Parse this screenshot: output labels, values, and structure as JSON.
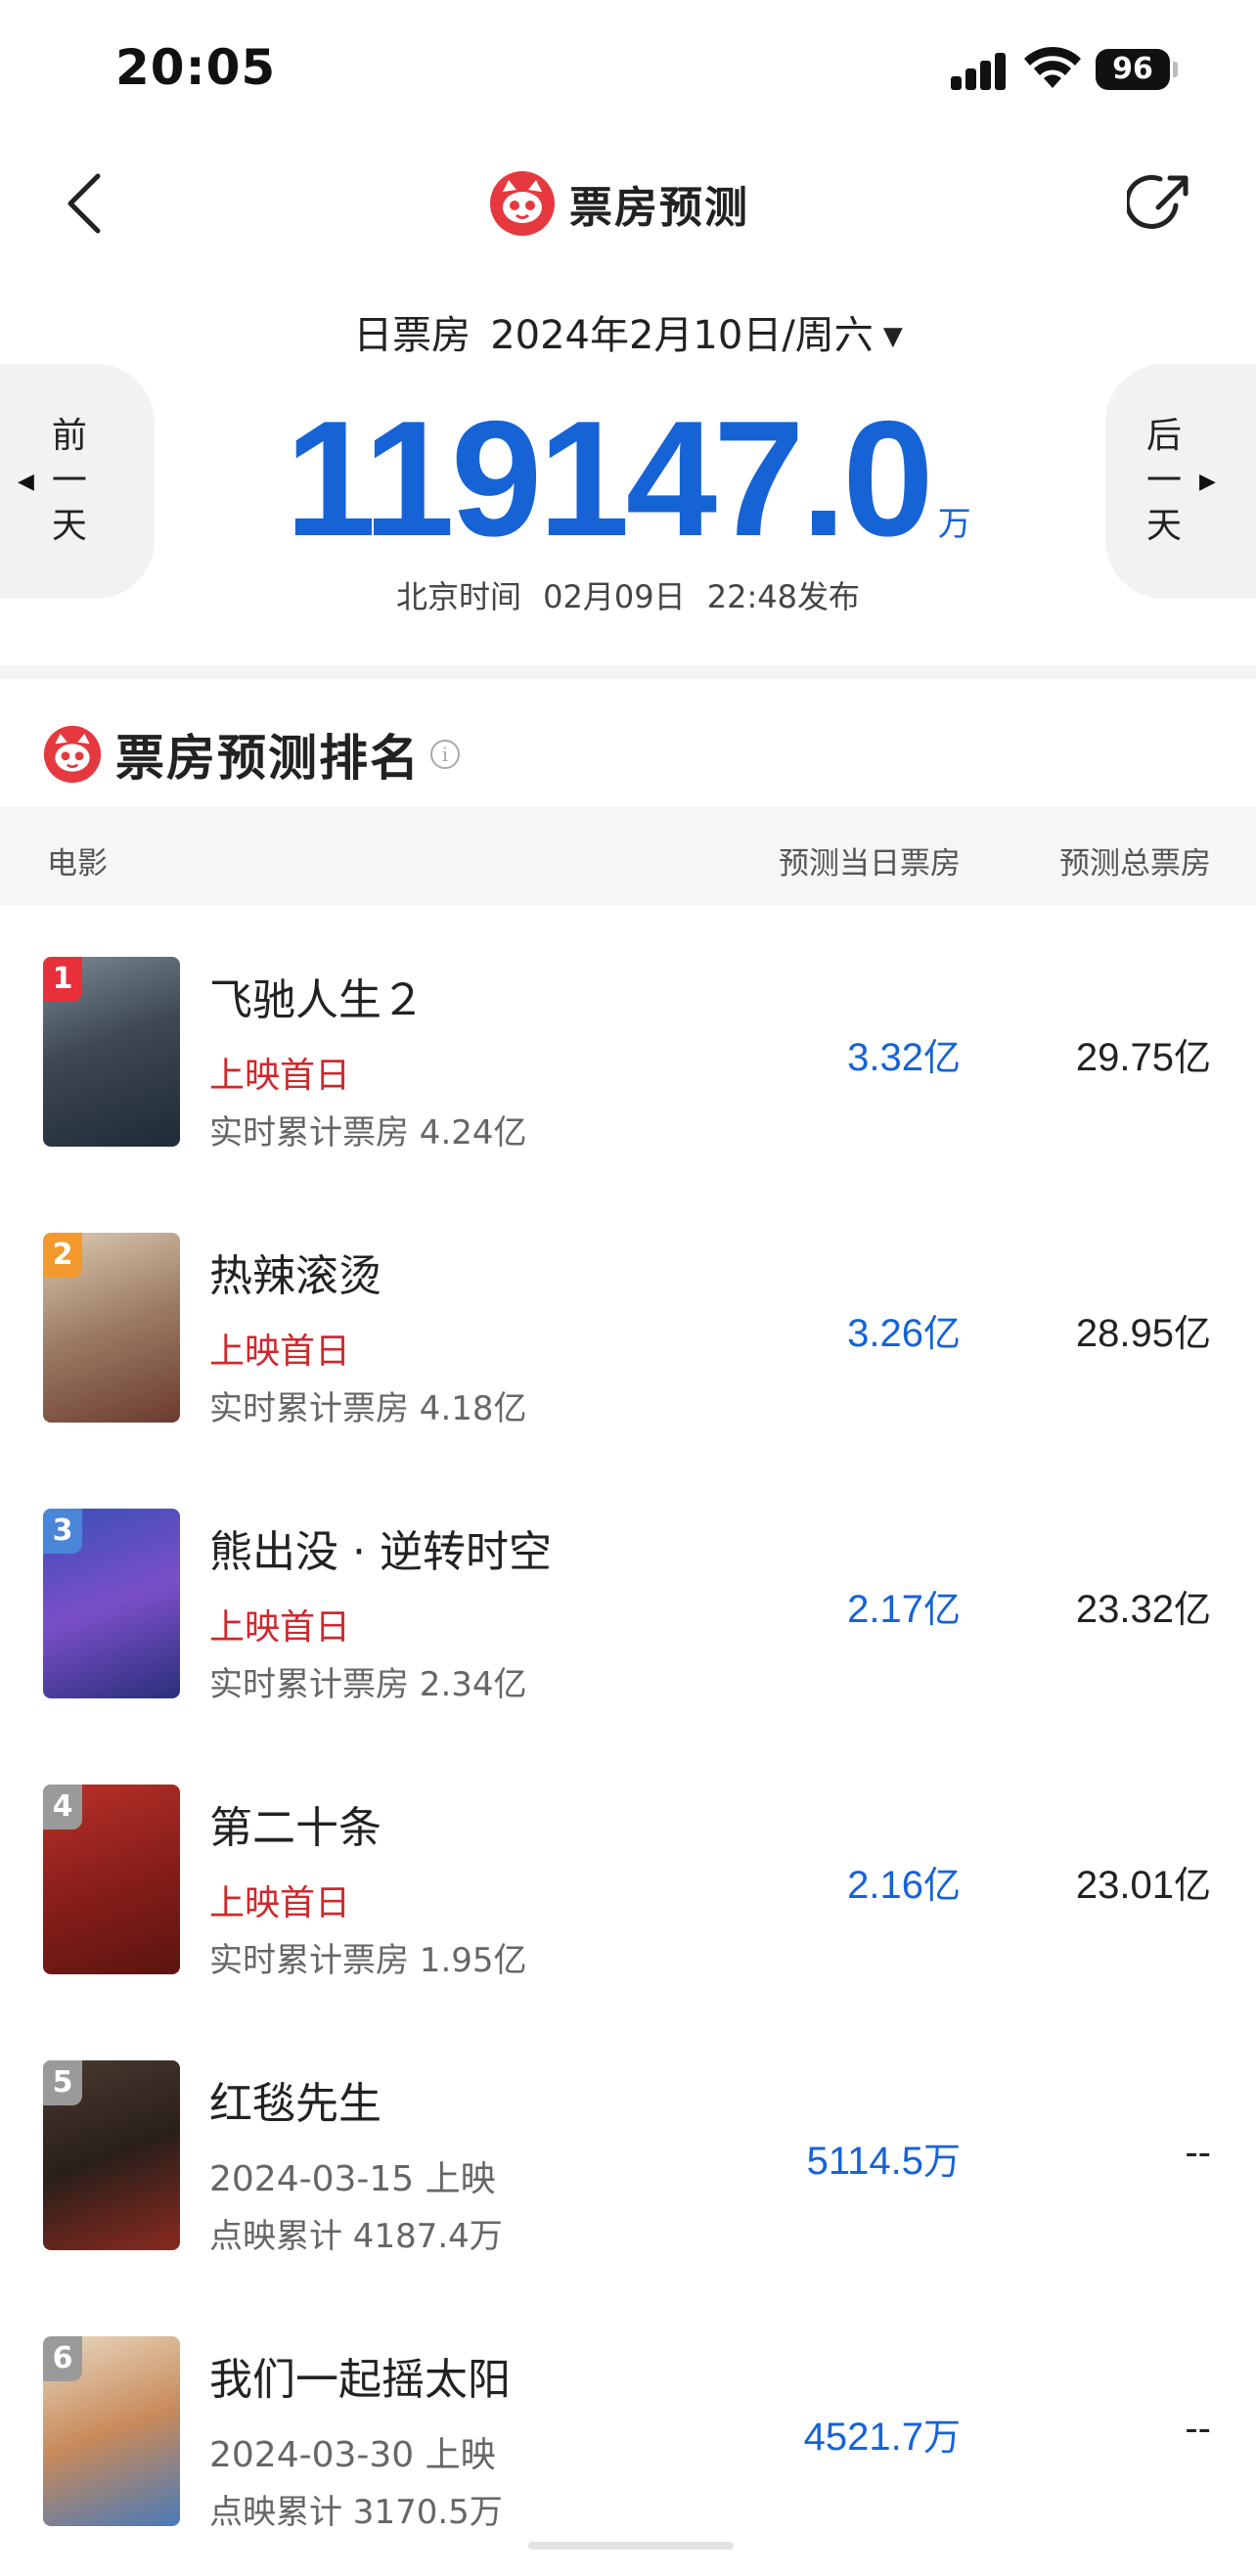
{
  "status_bar": {
    "time": "20:05",
    "battery": "96"
  },
  "nav": {
    "title": "票房预测"
  },
  "date": {
    "label": "日票房",
    "value": "2024年2月10日/周六",
    "caret": "▼"
  },
  "prev_day": {
    "c1": "前",
    "c2": "一",
    "c3": "天",
    "arrow": "◀"
  },
  "next_day": {
    "c1": "后",
    "c2": "一",
    "c3": "天",
    "arrow": "▶"
  },
  "total": {
    "value": "119147.0",
    "unit": "万"
  },
  "publish": {
    "tz": "北京时间",
    "date": "02月09日",
    "time": "22:48发布"
  },
  "ranking": {
    "title": "票房预测排名",
    "info": "i",
    "headers": {
      "movie": "电影",
      "day": "预测当日票房",
      "total": "预测总票房"
    },
    "rows": [
      {
        "rank": "1",
        "name": "飞驰人生２",
        "status": "上映首日",
        "cum": "实时累计票房 4.24亿",
        "day_value": "3.32",
        "day_unit": "亿",
        "total_value": "29.75",
        "total_unit": "亿",
        "badge_color": "#e8303a"
      },
      {
        "rank": "2",
        "name": "热辣滚烫",
        "status": "上映首日",
        "cum": "实时累计票房 4.18亿",
        "day_value": "3.26",
        "day_unit": "亿",
        "total_value": "28.95",
        "total_unit": "亿",
        "badge_color": "#f29a2e"
      },
      {
        "rank": "3",
        "name": "熊出没 · 逆转时空",
        "status": "上映首日",
        "cum": "实时累计票房 2.34亿",
        "day_value": "2.17",
        "day_unit": "亿",
        "total_value": "23.32",
        "total_unit": "亿",
        "badge_color": "#4a86d8"
      },
      {
        "rank": "4",
        "name": "第二十条",
        "status": "上映首日",
        "cum": "实时累计票房 1.95亿",
        "day_value": "2.16",
        "day_unit": "亿",
        "total_value": "23.01",
        "total_unit": "亿",
        "badge_color": "#9a9a9a"
      },
      {
        "rank": "5",
        "name": "红毯先生",
        "status": "2024-03-15 上映",
        "cum": "点映累计 4187.4万",
        "day_value": "5114.5",
        "day_unit": "万",
        "total_value": "--",
        "total_unit": "",
        "badge_color": "#9a9a9a"
      },
      {
        "rank": "6",
        "name": "我们一起摇太阳",
        "status": "2024-03-30 上映",
        "cum": "点映累计 3170.5万",
        "day_value": "4521.7",
        "day_unit": "万",
        "total_value": "--",
        "total_unit": "",
        "badge_color": "#9a9a9a"
      }
    ]
  }
}
